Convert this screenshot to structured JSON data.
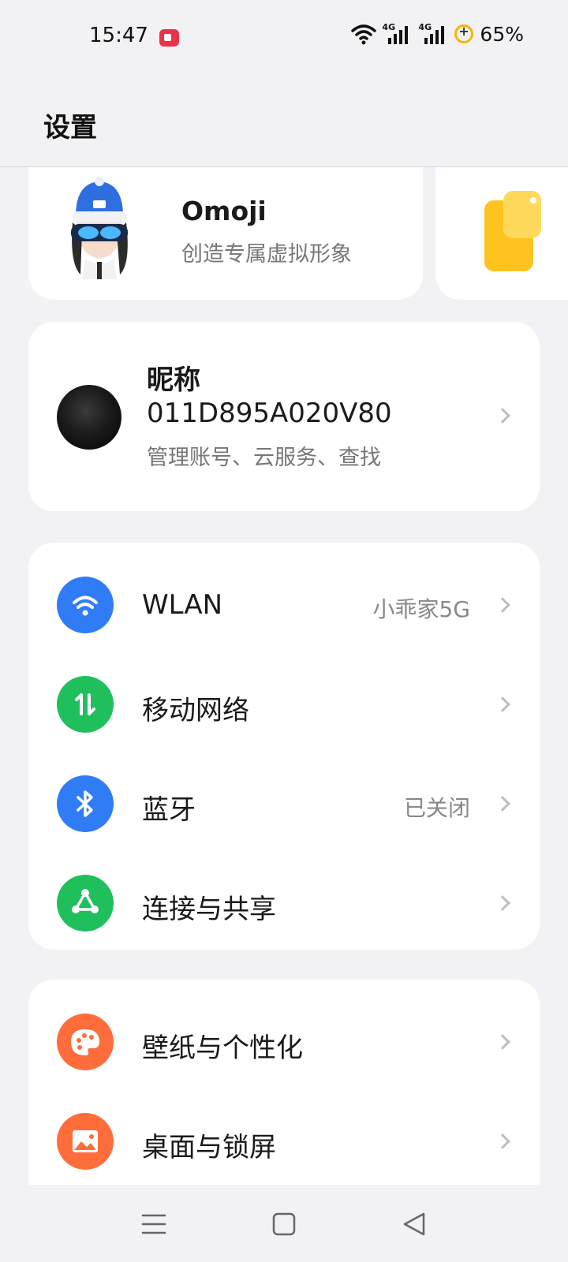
{
  "status_bar": {
    "time": "15:47",
    "network_1": "4G",
    "network_2": "4G",
    "battery": "65%"
  },
  "header": {
    "title": "设置"
  },
  "omoji": {
    "title": "Omoji",
    "subtitle": "创造专属虚拟形象"
  },
  "account": {
    "nickname": "昵称",
    "id": "011D895A020V80",
    "subtitle": "管理账号、云服务、查找"
  },
  "connectivity": [
    {
      "label": "WLAN",
      "value": "小乖家5G",
      "icon": "wifi-icon",
      "color": "#2f7cf6"
    },
    {
      "label": "移动网络",
      "value": "",
      "icon": "mobile-network-icon",
      "color": "#1fc05c"
    },
    {
      "label": "蓝牙",
      "value": "已关闭",
      "icon": "bluetooth-icon",
      "color": "#2f7cf6"
    },
    {
      "label": "连接与共享",
      "value": "",
      "icon": "share-icon",
      "color": "#1fc05c"
    }
  ],
  "personalization": [
    {
      "label": "壁纸与个性化",
      "icon": "palette-icon",
      "color": "#ff6d3b"
    },
    {
      "label": "桌面与锁屏",
      "icon": "picture-icon",
      "color": "#ff6d3b"
    }
  ],
  "nav": {
    "icons": [
      "menu-icon",
      "home-icon",
      "back-icon"
    ]
  }
}
